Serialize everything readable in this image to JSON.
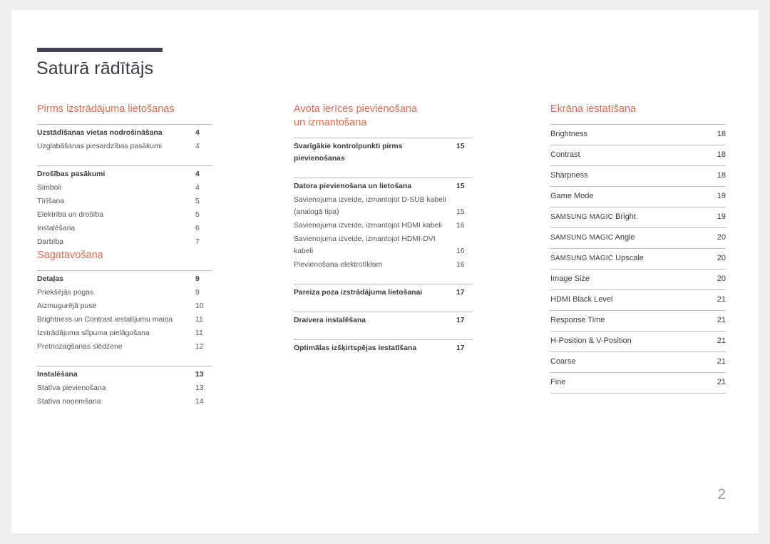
{
  "document": {
    "title": "Saturā rādītājs",
    "folio": "2",
    "accent_bar_color": "#454355",
    "section_heading_color": "#dd6b4f"
  },
  "columns": [
    {
      "id": "column-1",
      "sections": [
        {
          "heading": "Pirms izstrādājuma lietošanas",
          "groups": [
            {
              "entries": [
                {
                  "label": "Uzstādīšanas vietas nodrošināšana",
                  "page": "4",
                  "level": "head"
                },
                {
                  "label": "Uzglabāšanas piesardzības pasākumi",
                  "page": "4",
                  "level": "sub"
                }
              ]
            },
            {
              "entries": [
                {
                  "label": "Drošības pasākumi",
                  "page": "4",
                  "level": "head"
                },
                {
                  "label": "Simboli",
                  "page": "4",
                  "level": "sub"
                },
                {
                  "label": "Tīrīšana",
                  "page": "5",
                  "level": "sub"
                },
                {
                  "label": "Elektrība un drošība",
                  "page": "5",
                  "level": "sub"
                },
                {
                  "label": "Instalēšana",
                  "page": "6",
                  "level": "sub"
                },
                {
                  "label": "Darbība",
                  "page": "7",
                  "level": "sub"
                }
              ]
            }
          ]
        },
        {
          "heading": "Sagatavošana",
          "groups": [
            {
              "entries": [
                {
                  "label": "Detaļas",
                  "page": "9",
                  "level": "head"
                },
                {
                  "label": "Priekšējās pogas",
                  "page": "9",
                  "level": "sub"
                },
                {
                  "label": "Aizmugurējā puse",
                  "page": "10",
                  "level": "sub"
                },
                {
                  "label": "Brightness un Contrast iestatījumu maiņa",
                  "page": "11",
                  "level": "sub"
                },
                {
                  "label": "Izstrādājuma slīpuma pielāgošana",
                  "page": "11",
                  "level": "sub"
                },
                {
                  "label": "Pretnozagšanas slēdzene",
                  "page": "12",
                  "level": "sub"
                }
              ]
            },
            {
              "entries": [
                {
                  "label": "Instalēšana",
                  "page": "13",
                  "level": "head"
                },
                {
                  "label": "Statīva pievienošana",
                  "page": "13",
                  "level": "sub"
                },
                {
                  "label": "Statīva noņemšana",
                  "page": "14",
                  "level": "sub"
                }
              ]
            }
          ]
        }
      ]
    },
    {
      "id": "column-2",
      "sections": [
        {
          "heading": "Avota ierīces pievienošana\nun izmantošana",
          "groups": [
            {
              "entries": [
                {
                  "label": "Svarīgākie kontrolpunkti pirms pievienošanas",
                  "page": "15",
                  "level": "head"
                }
              ]
            },
            {
              "entries": [
                {
                  "label": "Datora pievienošana un lietošana",
                  "page": "15",
                  "level": "head"
                },
                {
                  "label": "Savienojuma izveide, izmantojot D-SUB kabeli\n(analogā tipa)",
                  "page": "15",
                  "level": "sub",
                  "two_line": true
                },
                {
                  "label": "Savienojuma izveide, izmantojot HDMI kabeli",
                  "page": "16",
                  "level": "sub"
                },
                {
                  "label": "Savienojuma izveide, izmantojot HDMI-DVI\nkabeli",
                  "page": "16",
                  "level": "sub",
                  "two_line": true
                },
                {
                  "label": "Pievienošana elektrotīklam",
                  "page": "16",
                  "level": "sub"
                }
              ]
            },
            {
              "entries": [
                {
                  "label": "Pareiza poza izstrādājuma lietošanai",
                  "page": "17",
                  "level": "head"
                }
              ]
            },
            {
              "entries": [
                {
                  "label": "Draivera instalēšana",
                  "page": "17",
                  "level": "head"
                }
              ]
            },
            {
              "entries": [
                {
                  "label": "Optimālas izšķirtspējas iestatīšana",
                  "page": "17",
                  "level": "head"
                }
              ]
            }
          ]
        }
      ]
    },
    {
      "id": "column-3",
      "sections": [
        {
          "heading": "Ekrāna iestatīšana",
          "rows": [
            {
              "label": "Brightness",
              "page": "18"
            },
            {
              "label": "Contrast",
              "page": "18"
            },
            {
              "label": "Sharpness",
              "page": "18"
            },
            {
              "label": "Game Mode",
              "page": "19"
            },
            {
              "label": "SAMSUNG MAGIC",
              "label_suffix": " Bright",
              "page": "19",
              "small_caps": true
            },
            {
              "label": "SAMSUNG MAGIC",
              "label_suffix": " Angle",
              "page": "20",
              "small_caps": true
            },
            {
              "label": "SAMSUNG MAGIC",
              "label_suffix": " Upscale",
              "page": "20",
              "small_caps": true
            },
            {
              "label": "Image Size",
              "page": "20"
            },
            {
              "label": "HDMI Black Level",
              "page": "21"
            },
            {
              "label": "Response Time",
              "page": "21"
            },
            {
              "label": "H-Position & V-Position",
              "page": "21"
            },
            {
              "label": "Coarse",
              "page": "21"
            },
            {
              "label": "Fine",
              "page": "21"
            }
          ]
        }
      ]
    }
  ]
}
